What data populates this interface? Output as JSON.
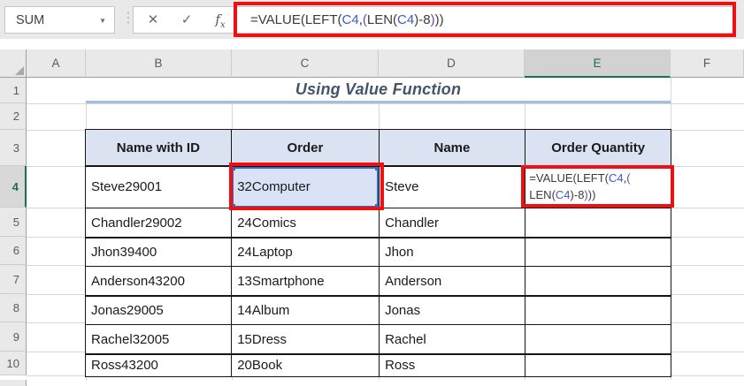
{
  "formula_bar": {
    "name_box_value": "SUM",
    "dropdown_glyph": "▼",
    "drag_handle_glyph": "⋮",
    "cancel_glyph": "✕",
    "enter_glyph": "✓",
    "fx_label": "f",
    "fx_sub": "x",
    "formula_full": "=VALUE(LEFT(C4,(LEN(C4)-8)))",
    "formula_segments": [
      {
        "t": "=VALUE(LEFT(",
        "c": "default"
      },
      {
        "t": "C4",
        "c": "ref"
      },
      {
        "t": ",",
        "c": "default"
      },
      {
        "t": "(",
        "c": "purple"
      },
      {
        "t": "LEN(",
        "c": "default"
      },
      {
        "t": "C4",
        "c": "ref"
      },
      {
        "t": ")-8",
        "c": "default"
      },
      {
        "t": ")",
        "c": "purple"
      },
      {
        "t": "))",
        "c": "default"
      }
    ]
  },
  "grid": {
    "column_labels": [
      "A",
      "B",
      "C",
      "D",
      "E",
      "F"
    ],
    "row_labels": [
      "1",
      "2",
      "3",
      "4",
      "5",
      "6",
      "7",
      "8",
      "9",
      "10"
    ],
    "selected_column": "E",
    "selected_row": "4"
  },
  "sheet": {
    "title": "Using Value Function",
    "table": {
      "headers": [
        "Name with ID",
        "Order",
        "Name",
        "Order Quantity"
      ],
      "rows": [
        {
          "name_with_id": "Steve29001",
          "order": "32Computer",
          "name": "Steve",
          "order_quantity": ""
        },
        {
          "name_with_id": "Chandler29002",
          "order": "24Comics",
          "name": "Chandler",
          "order_quantity": ""
        },
        {
          "name_with_id": "Jhon39400",
          "order": "24Laptop",
          "name": "Jhon",
          "order_quantity": ""
        },
        {
          "name_with_id": "Anderson43200",
          "order": "13Smartphone",
          "name": "Anderson",
          "order_quantity": ""
        },
        {
          "name_with_id": "Jonas29005",
          "order": "14Album",
          "name": "Jonas",
          "order_quantity": ""
        },
        {
          "name_with_id": "Rachel32005",
          "order": "15Dress",
          "name": "Rachel",
          "order_quantity": ""
        },
        {
          "name_with_id": "Ross43200",
          "order": "20Book",
          "name": "Ross",
          "order_quantity": ""
        }
      ],
      "active_cell": "E4",
      "highlighted_reference_cell": "C4",
      "active_cell_formula_lines": [
        [
          {
            "t": "=VALUE(LEFT(",
            "c": "default"
          },
          {
            "t": "C4",
            "c": "ref"
          },
          {
            "t": ",",
            "c": "default"
          },
          {
            "t": "(",
            "c": "purple"
          }
        ],
        [
          {
            "t": "LEN(",
            "c": "default"
          },
          {
            "t": "C4",
            "c": "ref"
          },
          {
            "t": ")-8",
            "c": "default"
          },
          {
            "t": ")",
            "c": "purple"
          },
          {
            "t": "))",
            "c": "default"
          }
        ]
      ]
    }
  },
  "colors": {
    "red_highlight": "#ee1111",
    "reference_blue": "#3a5bc7",
    "paren_purple": "#7b3fa8",
    "formula_text": "#3b3b3b",
    "cell_text": "#1a1a1a",
    "title_text": "#44546a",
    "title_underline": "#a3bede",
    "table_header_fill": "#dbe2f1",
    "c4_fill": "#d9e3f5",
    "c4_border": "#3c66c4",
    "selection_green": "#1f7246"
  }
}
